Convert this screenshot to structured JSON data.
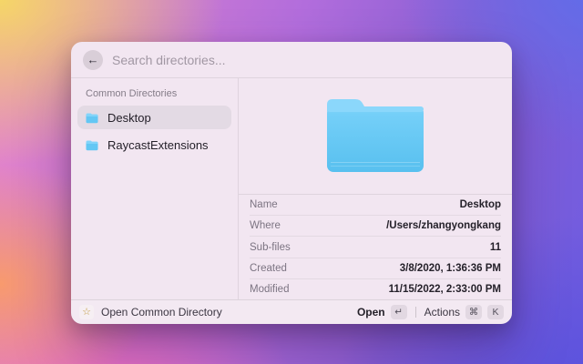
{
  "window": {
    "search": {
      "placeholder": "Search directories...",
      "back_icon": "←"
    },
    "sidebar": {
      "section_title": "Common Directories",
      "items": [
        {
          "label": "Desktop",
          "selected": true
        },
        {
          "label": "RaycastExtensions",
          "selected": false
        }
      ]
    },
    "detail": {
      "preview_icon": "blue-folder-icon",
      "metadata": [
        {
          "label": "Name",
          "value": "Desktop"
        },
        {
          "label": "Where",
          "value": "/Users/zhangyongkang"
        },
        {
          "label": "Sub-files",
          "value": "11"
        },
        {
          "label": "Created",
          "value": "3/8/2020, 1:36:36 PM"
        },
        {
          "label": "Modified",
          "value": "11/15/2022, 2:33:00 PM"
        }
      ]
    },
    "footer": {
      "star_icon": "☆",
      "action_label": "Open Common Directory",
      "primary_label": "Open",
      "primary_key": "↵",
      "secondary_label": "Actions",
      "secondary_keys": {
        "cmd": "⌘",
        "k": "K"
      }
    }
  },
  "colors": {
    "folder_tab": "#8bd7fb",
    "folder_body_top": "#82d4fa",
    "folder_body_bottom": "#58c0ef",
    "window_bg": "#f2e6f1",
    "selection_bg": "#e3dae4",
    "bg_yellow": "#f5d667",
    "bg_orange": "#f89a6d",
    "bg_pink": "#ef6fc0",
    "bg_purple": "#8a5fd5",
    "bg_blue": "#5b52dd"
  }
}
